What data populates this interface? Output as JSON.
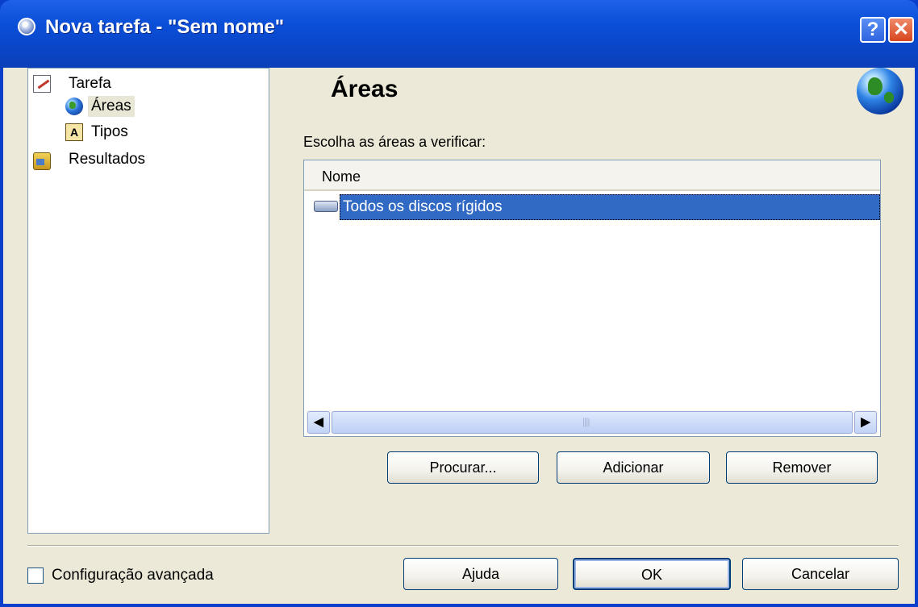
{
  "window": {
    "title": "Nova tarefa - \"Sem nome\"",
    "help_label": "?",
    "close_label": "✕"
  },
  "tree": {
    "items": [
      {
        "label": "Tarefa",
        "icon": "task-edit-icon",
        "level": 0
      },
      {
        "label": "Áreas",
        "icon": "globe-icon",
        "level": 1,
        "selected": true
      },
      {
        "label": "Tipos",
        "icon": "file-types-icon",
        "level": 1
      },
      {
        "label": "Resultados",
        "icon": "results-chest-icon",
        "level": 0
      }
    ],
    "types_icon_glyph": "A"
  },
  "main": {
    "title": "Áreas",
    "prompt_label": "Escolha as áreas a verificar:",
    "list": {
      "column_header": "Nome",
      "rows": [
        {
          "label": "Todos os discos rígidos",
          "icon": "hard-drive-icon",
          "selected": true
        }
      ]
    },
    "scroll": {
      "left_glyph": "◀",
      "right_glyph": "▶"
    },
    "buttons": {
      "browse": "Procurar...",
      "add": "Adicionar",
      "remove": "Remover"
    }
  },
  "footer": {
    "advanced_label": "Configuração avançada",
    "advanced_checked": false,
    "help": "Ajuda",
    "ok": "OK",
    "cancel": "Cancelar"
  },
  "colors": {
    "titlebar": "#0a46c8",
    "selection": "#316ac5",
    "dialog_bg": "#ece9d8"
  }
}
